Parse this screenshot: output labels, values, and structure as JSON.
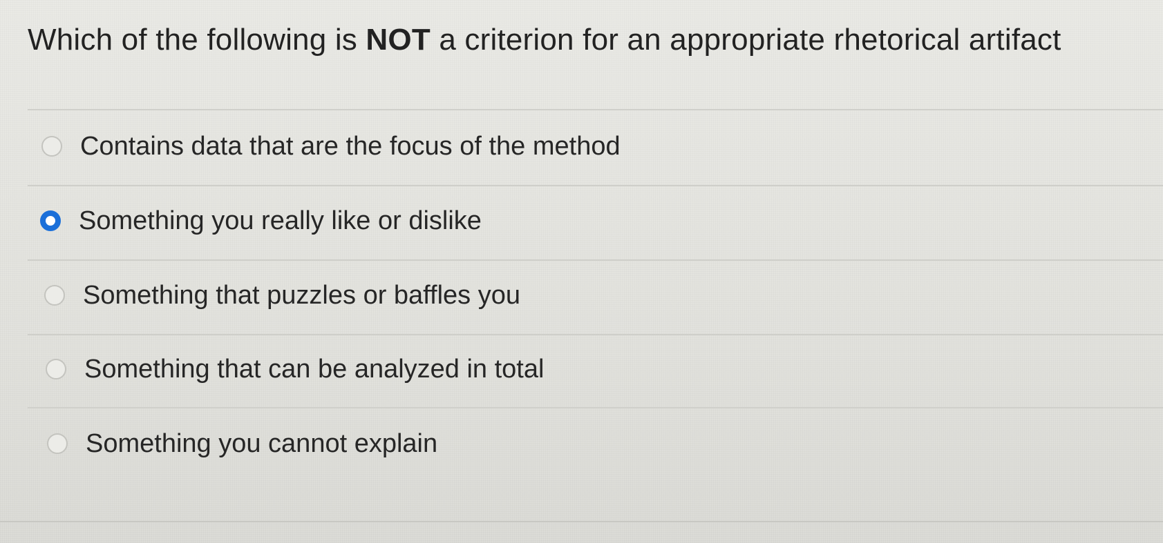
{
  "question": {
    "prefix": "Which of the following is ",
    "emphasis": "NOT",
    "suffix": " a criterion for an appropriate rhetorical artifact"
  },
  "options": [
    {
      "label": "Contains data that are the focus of the method",
      "selected": false
    },
    {
      "label": "Something you really like or dislike",
      "selected": true
    },
    {
      "label": "Something that puzzles or baffles you",
      "selected": false
    },
    {
      "label": "Something that can be analyzed in total",
      "selected": false
    },
    {
      "label": "Something you cannot explain",
      "selected": false
    }
  ],
  "colors": {
    "accent": "#1a6fd9",
    "background": "#e7e7e2"
  }
}
